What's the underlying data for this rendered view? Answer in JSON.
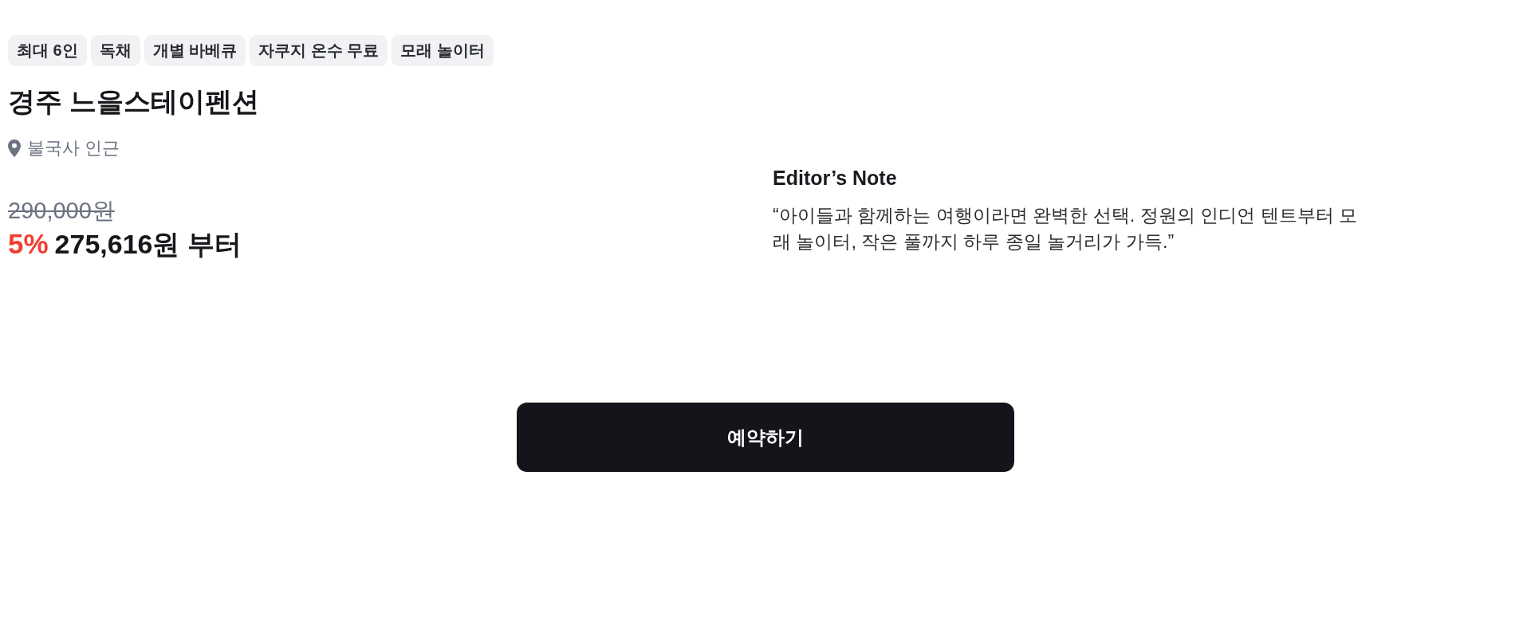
{
  "tags": [
    "최대 6인",
    "독채",
    "개별 바베큐",
    "자쿠지 온수 무료",
    "모래 놀이터"
  ],
  "title": "경주 느을스테이펜션",
  "location": "불국사 인근",
  "price": {
    "original": "290,000원",
    "discount": "5%",
    "final": "275,616원 부터"
  },
  "editor_note": {
    "heading": "Editor’s Note",
    "quote": "“아이들과 함께하는 여행이라면 완벽한 선택. 정원의 인디언 텐트부터 모래 놀이터, 작은 풀까지 하루 종일 놀거리가 가득.”"
  },
  "button": {
    "label": "예약하기"
  }
}
